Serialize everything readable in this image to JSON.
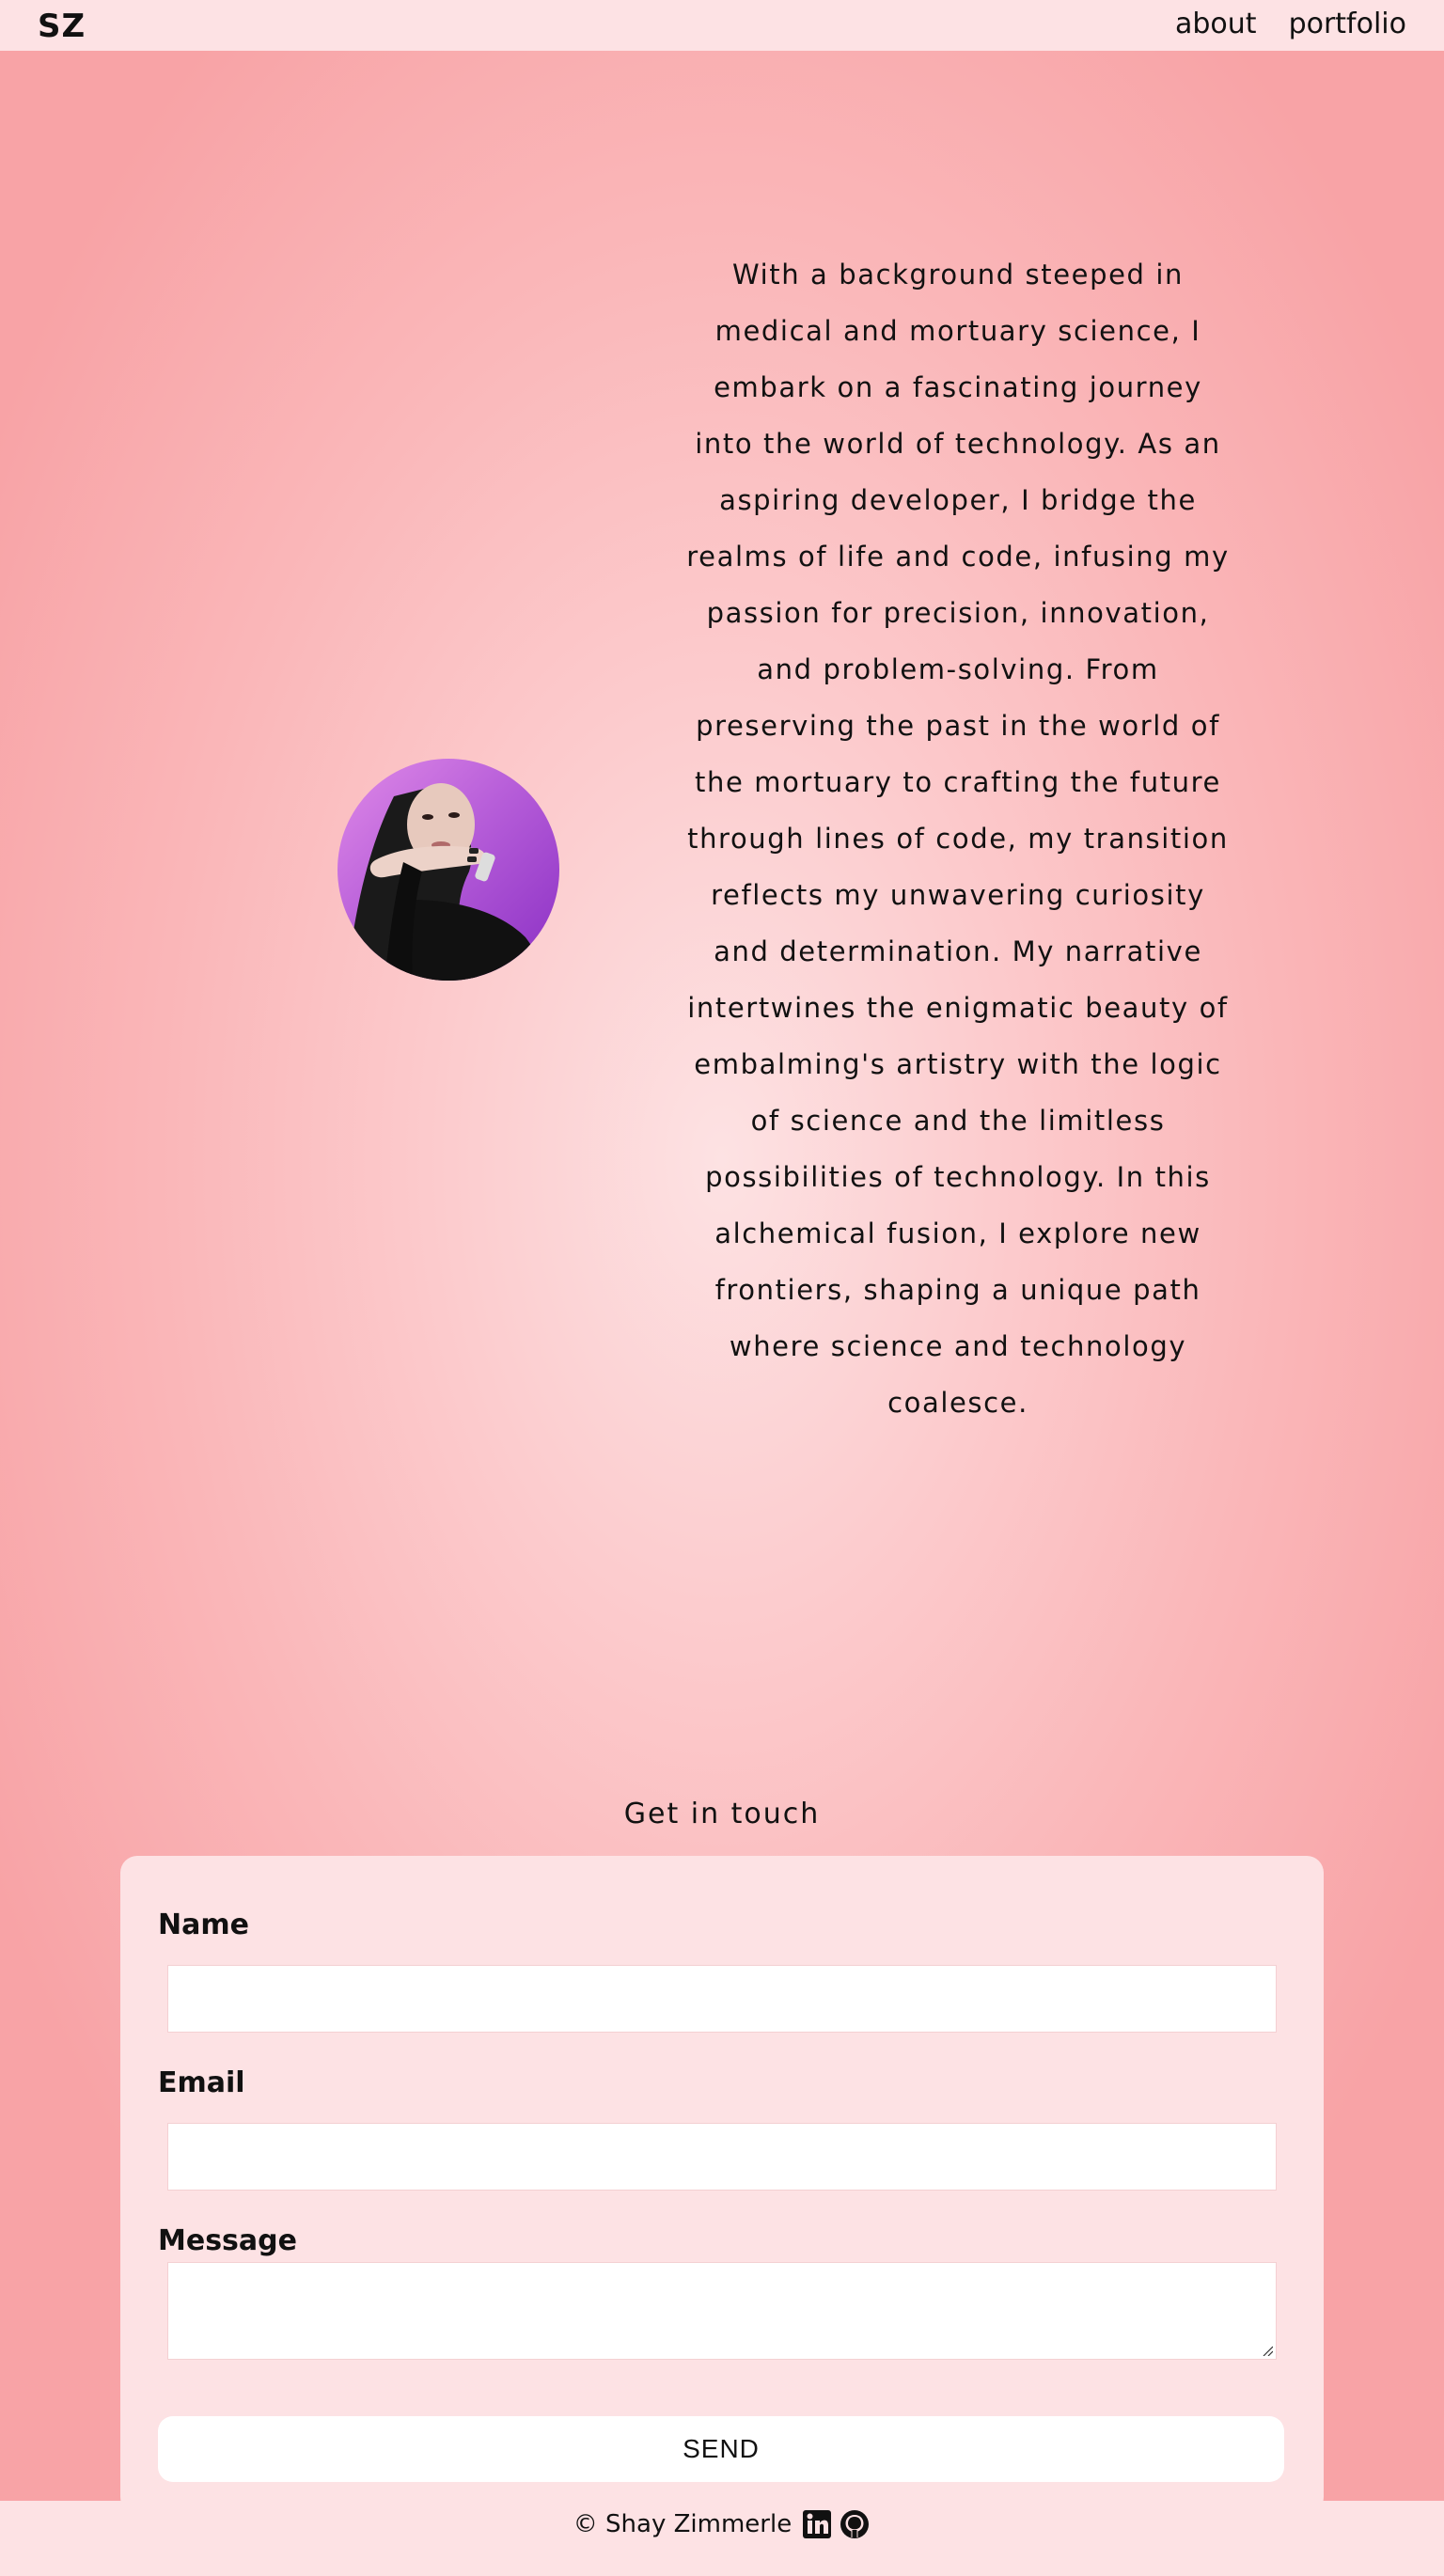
{
  "header": {
    "logo": "SZ",
    "nav": [
      {
        "label": "about"
      },
      {
        "label": "portfolio"
      }
    ]
  },
  "about": {
    "bio": "With a background steeped in medical and mortuary science, I embark on a fascinating journey into the world of technology. As an aspiring developer, I bridge the realms of life and code, infusing my passion for precision, innovation, and problem-solving. From preserving the past in the world of the mortuary to crafting the future through lines of code, my transition reflects my unwavering curiosity and determination. My narrative intertwines the enigmatic beauty of embalming's artistry with the logic of science and the limitless possibilities of technology. In this alchemical fusion, I explore new frontiers, shaping a unique path where science and technology coalesce."
  },
  "contact": {
    "heading": "Get in touch",
    "name_label": "Name",
    "name_value": "",
    "email_label": "Email",
    "email_value": "",
    "message_label": "Message",
    "message_value": "",
    "send_label": "SEND"
  },
  "footer": {
    "copyright": "© Shay Zimmerle",
    "icons": [
      "linkedin-icon",
      "github-icon"
    ]
  },
  "colors": {
    "background_center": "#fde2e3",
    "background_edge": "#f8a3a6",
    "panel": "#fde2e4",
    "avatar_gradient_start": "#e08ae8",
    "avatar_gradient_end": "#8a2fc4"
  }
}
